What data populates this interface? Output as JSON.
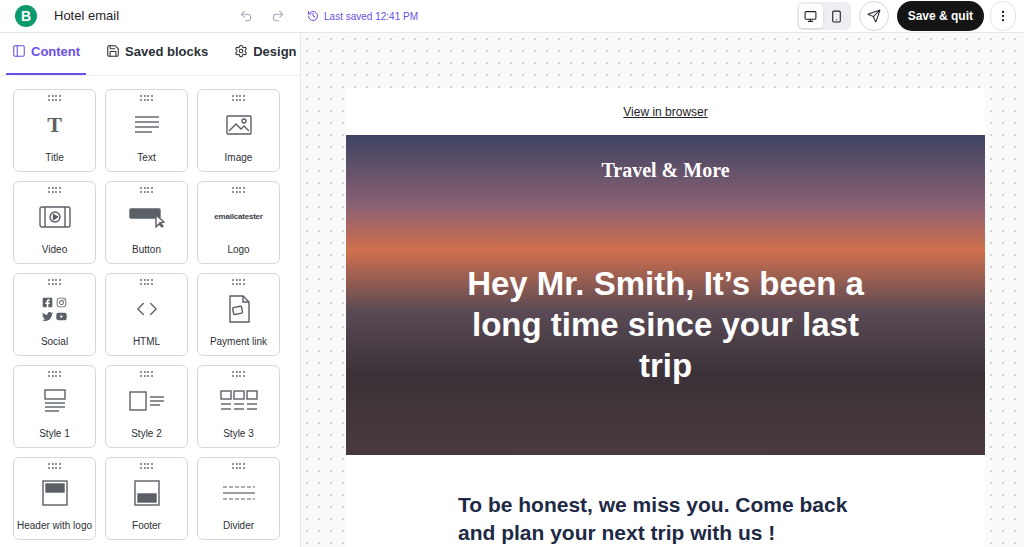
{
  "app": {
    "logo": "B",
    "title": "Hotel email",
    "last_saved": "Last saved 12:41 PM"
  },
  "device_toggle": [
    {
      "device": "desktop",
      "selected": true
    },
    {
      "device": "mobile",
      "selected": false
    }
  ],
  "actions": {
    "save": "Save & quit"
  },
  "tabs": [
    {
      "label": "Content",
      "selected": true,
      "kind": "content"
    },
    {
      "label": "Saved blocks",
      "selected": false,
      "kind": "saved"
    },
    {
      "label": "Design",
      "selected": false,
      "kind": "design"
    }
  ],
  "blocks": [
    {
      "label": "Title",
      "kind": "title",
      "glyph": "T"
    },
    {
      "label": "Text",
      "kind": "text"
    },
    {
      "label": "Image",
      "kind": "image"
    },
    {
      "label": "Video",
      "kind": "video"
    },
    {
      "label": "Button",
      "kind": "button"
    },
    {
      "label": "Logo",
      "kind": "logo",
      "glyph": "emailcatester"
    },
    {
      "label": "Social",
      "kind": "social"
    },
    {
      "label": "HTML",
      "kind": "html"
    },
    {
      "label": "Payment link",
      "kind": "payment"
    },
    {
      "label": "Style 1",
      "kind": "style1"
    },
    {
      "label": "Style 2",
      "kind": "style2"
    },
    {
      "label": "Style 3",
      "kind": "style3"
    },
    {
      "label": "Header with logo",
      "kind": "header"
    },
    {
      "label": "Footer",
      "kind": "footer"
    },
    {
      "label": "Divider",
      "kind": "divider"
    }
  ],
  "email": {
    "view_in_browser": "View in browser",
    "brand": "Travel & More",
    "headline": "Hey Mr. Smith, It’s been a long time since your last trip",
    "body": "To be honest, we miss you. Come back and plan your next trip with us !"
  }
}
